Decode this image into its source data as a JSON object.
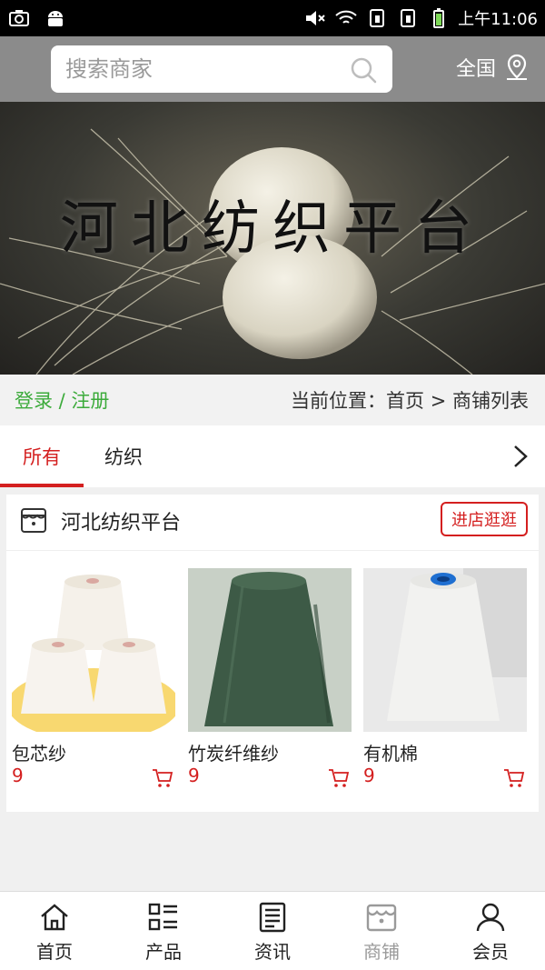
{
  "status_bar": {
    "time": "上午11:06"
  },
  "header": {
    "search_placeholder": "搜索商家",
    "region_label": "全国"
  },
  "banner": {
    "title": "河北纺织平台"
  },
  "location_bar": {
    "login_label": "登录 / 注册",
    "breadcrumb": "当前位置：首页 > 商铺列表"
  },
  "tabs": [
    {
      "label": "所有",
      "active": true
    },
    {
      "label": "纺织",
      "active": false
    }
  ],
  "store": {
    "name": "河北纺织平台",
    "visit_label": "进店逛逛",
    "products": [
      {
        "name": "包芯纱",
        "price": "9"
      },
      {
        "name": "竹炭纤维纱",
        "price": "9"
      },
      {
        "name": "有机棉",
        "price": "9"
      }
    ]
  },
  "bottom_nav": [
    {
      "label": "首页",
      "icon": "home-icon"
    },
    {
      "label": "产品",
      "icon": "product-list-icon"
    },
    {
      "label": "资讯",
      "icon": "news-icon"
    },
    {
      "label": "商铺",
      "icon": "store-icon",
      "active": true
    },
    {
      "label": "会员",
      "icon": "member-icon"
    }
  ],
  "colors": {
    "accent_red": "#d41f1f",
    "login_green": "#3cab3b",
    "header_gray": "#8b8b8b"
  }
}
